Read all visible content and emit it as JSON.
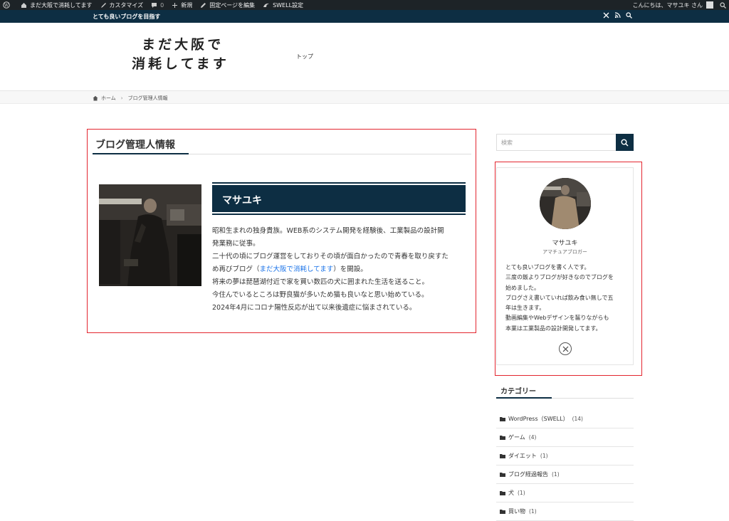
{
  "admin_bar": {
    "site_name": "まだ大阪で消耗してます",
    "customize": "カスタマイズ",
    "comments": "0",
    "new": "新規",
    "edit_page": "固定ページを編集",
    "swell": "SWELL設定",
    "greeting": "こんにちは、マサユキ さん"
  },
  "topbar": {
    "tagline": "とても良いブログを目指す"
  },
  "header": {
    "logo_line1": "まだ大阪で",
    "logo_line2": "消耗してます",
    "nav_top": "トップ"
  },
  "breadcrumb": {
    "home": "ホーム",
    "current": "ブログ管理人情報"
  },
  "main": {
    "page_title": "ブログ管理人情報",
    "name": "マサユキ",
    "bio": [
      "昭和生まれの独身貴族。WEB系のシステム開発を経験後、工業製品の設計開",
      "発業務に従事。",
      "二十代の頃にブログ運営をしておりその頃が面白かったので青春を取り戻すた",
      "め再びブログ（",
      "まだ大阪で消耗してます",
      "）を開設。",
      "将来の夢は琵琶湖付近で家を買い数匹の犬に囲まれた生活を送ること。",
      "今住んでいるところは野良猫が多いため猫も良いなと思い始めている。",
      "2024年4月にコロナ陽性反応が出て以来後遺症に悩まされている。"
    ]
  },
  "sidebar": {
    "search_placeholder": "検索",
    "profile": {
      "name": "マサユキ",
      "role": "アマチュアブロガー",
      "desc": [
        "とても良いブログを書く人です。",
        "三度の飯よりブログが好きなのでブログを",
        "始めました。",
        "ブログさえ書いていれば飲み食い無しで五",
        "年は生きます。",
        "動画編集やWebデザインを齧りながらも",
        "本業は工業製品の設計開発してます。"
      ]
    },
    "categories_title": "カテゴリー",
    "categories": [
      {
        "label": "WordPress（SWELL）",
        "count": "(14)"
      },
      {
        "label": "ゲーム",
        "count": "(4)"
      },
      {
        "label": "ダイエット",
        "count": "(1)"
      },
      {
        "label": "ブログ経過報告",
        "count": "(1)"
      },
      {
        "label": "犬",
        "count": "(1)"
      },
      {
        "label": "買い物",
        "count": "(1)"
      }
    ]
  },
  "colors": {
    "brand": "#0d2e43",
    "admin_bar": "#1d2327",
    "highlight_box": "#e3262f",
    "link": "#1a73e8"
  }
}
